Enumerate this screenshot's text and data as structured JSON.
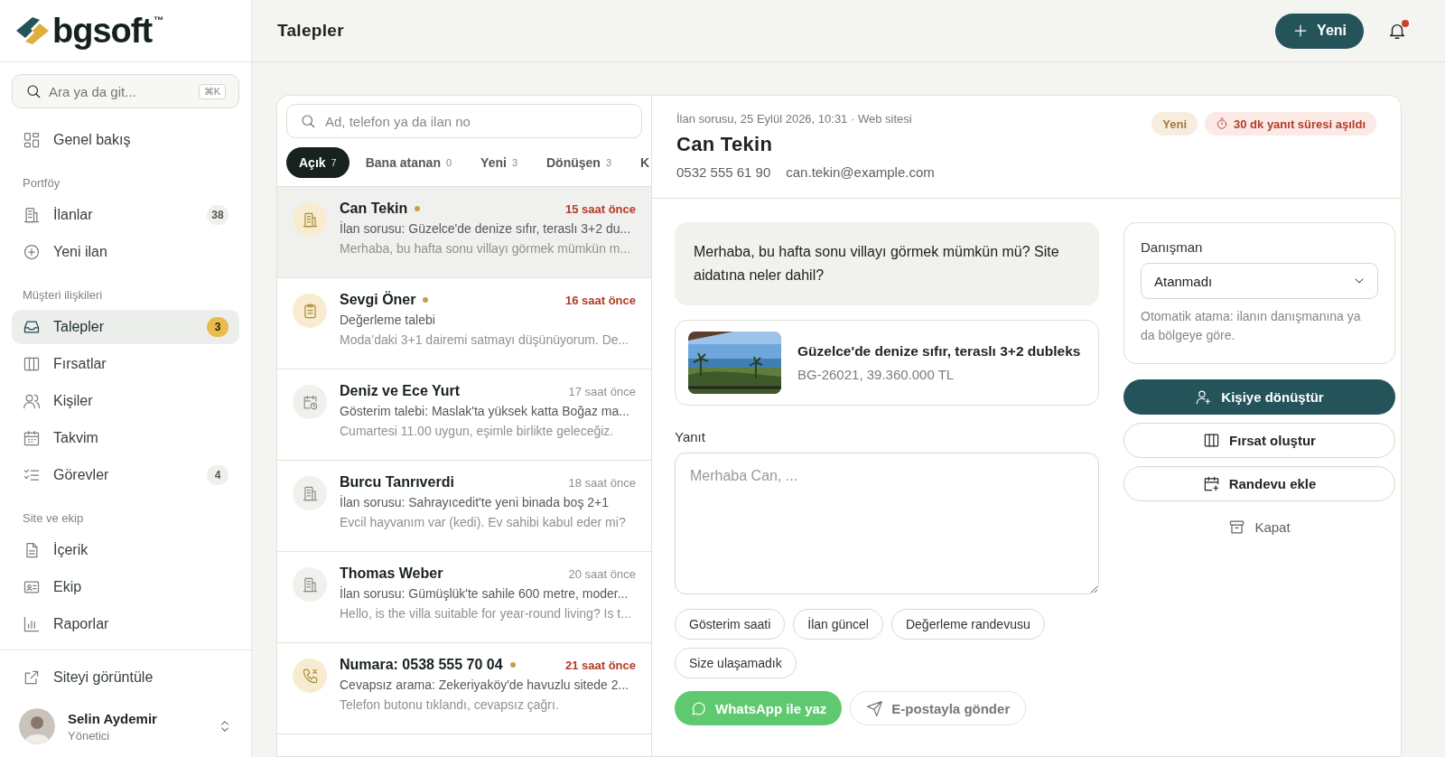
{
  "brand": {
    "name": "bgsoft",
    "mark": "™"
  },
  "sidebar": {
    "search": {
      "placeholder": "Ara ya da git...",
      "shortcut": "⌘K"
    },
    "sections": [
      {
        "items": [
          {
            "label": "Genel bakış",
            "selected": false
          }
        ]
      },
      {
        "title": "Portföy",
        "items": [
          {
            "label": "İlanlar",
            "badge": "38",
            "badge_highlight": false,
            "selected": false
          },
          {
            "label": "Yeni ilan",
            "selected": false
          }
        ]
      },
      {
        "title": "Müşteri ilişkileri",
        "items": [
          {
            "label": "Talepler",
            "badge": "3",
            "badge_highlight": true,
            "selected": true
          },
          {
            "label": "Fırsatlar",
            "selected": false
          },
          {
            "label": "Kişiler",
            "selected": false
          },
          {
            "label": "Takvim",
            "selected": false
          },
          {
            "label": "Görevler",
            "badge": "4",
            "badge_highlight": false,
            "selected": false
          }
        ]
      },
      {
        "title": "Site ve ekip",
        "items": [
          {
            "label": "İçerik",
            "selected": false
          },
          {
            "label": "Ekip",
            "selected": false
          },
          {
            "label": "Raporlar",
            "selected": false
          }
        ]
      }
    ],
    "footer_link": "Siteyi görüntüle",
    "user": {
      "name": "Selin Aydemir",
      "role": "Yönetici"
    }
  },
  "header": {
    "title": "Talepler",
    "new_button": "Yeni",
    "notifications": true
  },
  "inbox": {
    "search": {
      "placeholder": "Ad, telefon ya da ilan no"
    },
    "tabs": [
      {
        "label": "Açık",
        "count": "7",
        "selected": true
      },
      {
        "label": "Bana atanan",
        "count": "0",
        "selected": false
      },
      {
        "label": "Yeni",
        "count": "3",
        "selected": false
      },
      {
        "label": "Dönüşen",
        "count": "3",
        "selected": false
      },
      {
        "label": "K",
        "selected": false
      }
    ],
    "items": [
      {
        "name": "Can Tekin",
        "kind": "listing",
        "unread": true,
        "selected": true,
        "time": "15 saat önce",
        "subject": "İlan sorusu: Güzelce'de denize sıfır, teraslı 3+2 du...",
        "preview": "Merhaba, bu hafta sonu villayı görmek mümkün m..."
      },
      {
        "name": "Sevgi Öner",
        "kind": "valuation",
        "unread": true,
        "selected": false,
        "time": "16 saat önce",
        "subject": "Değerleme talebi",
        "preview": "Moda’daki 3+1 dairemi satmayı düşünüyorum. De..."
      },
      {
        "name": "Deniz ve Ece Yurt",
        "kind": "showing",
        "unread": false,
        "selected": false,
        "time": "17 saat önce",
        "subject": "Gösterim talebi: Maslak'ta yüksek katta Boğaz ma...",
        "preview": "Cumartesi 11.00 uygun, eşimle birlikte geleceğiz."
      },
      {
        "name": "Burcu Tanrıverdi",
        "kind": "listing",
        "unread": false,
        "selected": false,
        "time": "18 saat önce",
        "subject": "İlan sorusu: Sahrayıcedit'te yeni binada boş 2+1",
        "preview": "Evcil hayvanım var (kedi). Ev sahibi kabul eder mi?"
      },
      {
        "name": "Thomas Weber",
        "kind": "listing",
        "unread": false,
        "selected": false,
        "time": "20 saat önce",
        "subject": "İlan sorusu: Gümüşlük'te sahile 600 metre, moder...",
        "preview": "Hello, is the villa suitable for year-round living? Is t..."
      },
      {
        "name": "Numara: 0538 555 70 04",
        "kind": "call",
        "unread": true,
        "selected": false,
        "time": "21 saat önce",
        "subject": "Cevapsız arama: Zekeriyaköy'de havuzlu sitede 2...",
        "preview": "Telefon butonu tıklandı, cevapsız çağrı."
      }
    ]
  },
  "detail": {
    "meta": "İlan sorusu, 25 Eylül 2026, 10:31 · Web sitesi",
    "name": "Can Tekin",
    "phone": "0532 555 61 90",
    "email": "can.tekin@example.com",
    "tags": [
      {
        "label": "Yeni",
        "kind": "status"
      },
      {
        "label": "30 dk yanıt süresi aşıldı",
        "kind": "warning"
      }
    ],
    "message": "Merhaba, bu hafta sonu villayı görmek mümkün mü? Site aidatına neler dahil?",
    "listing": {
      "title": "Güzelce'de denize sıfır, teraslı 3+2 dubleks",
      "info": "BG-26021, 39.360.000 TL"
    },
    "reply": {
      "label": "Yanıt",
      "placeholder": "Merhaba Can, ..."
    },
    "quick_replies": [
      "Gösterim saati",
      "İlan güncel",
      "Değerleme randevusu",
      "Size ulaşamadık"
    ],
    "send_buttons": [
      {
        "label": "WhatsApp ile yaz",
        "kind": "whatsapp"
      },
      {
        "label": "E-postayla gönder",
        "kind": "email"
      }
    ],
    "advisor": {
      "label": "Danışman",
      "value": "Atanmadı",
      "hint": "Otomatik atama: ilanın danışmanına ya da bölgeye göre."
    },
    "actions": [
      {
        "label": "Kişiye dönüştür",
        "kind": "primary"
      },
      {
        "label": "Fırsat oluştur",
        "kind": "outline"
      },
      {
        "label": "Randevu ekle",
        "kind": "outline"
      },
      {
        "label": "Kapat",
        "kind": "plain"
      }
    ]
  }
}
